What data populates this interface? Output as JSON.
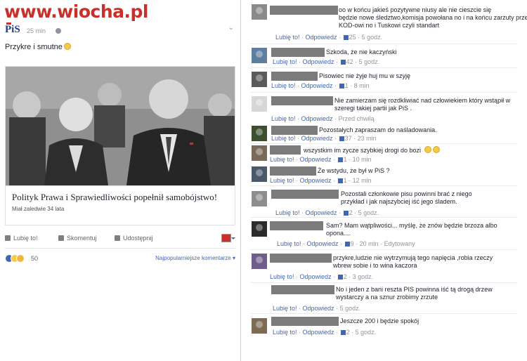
{
  "watermark": "www.wiocha.pl",
  "post": {
    "page_logo": "PiS",
    "time": "25 min",
    "text": "Przykre i smutne",
    "link_title": "Polityk Prawa i Sprawiedliwości popełnił samobójstwo!",
    "link_desc": "Miał zaledwie 34 lata",
    "actions": {
      "like": "Lubię to!",
      "comment": "Skomentuj",
      "share": "Udostępnij"
    },
    "reactions_count": "50",
    "sort_label": "Najpopularniejsze komentarze ▾"
  },
  "comments": [
    {
      "text": "oo w końcu jakieś pozytywne niusy ale nie cieszcie się\nbędzie nowe śledztwo,komisja powołana no i na końcu zarzuty przeciwko\nKOD-owi no i Tuskowi czyli standart",
      "meta": {
        "like": "Lubię to!",
        "reply": "Odpowiedz",
        "count": "25",
        "time": "5 godz."
      }
    },
    {
      "text": "Szkoda, że nie kaczyński",
      "meta": {
        "like": "Lubię to!",
        "reply": "Odpowiedz",
        "count": "42",
        "time": "5 godz."
      }
    },
    {
      "text": "Pisowiec nie żyje huj mu w szyję",
      "meta": {
        "like": "Lubię to!",
        "reply": "Odpowiedz",
        "count": "1",
        "time": "8 min"
      }
    },
    {
      "text": "Nie zamierzam się rozdkliwiać nad człowiekiem który wstąpił w\nszeregi takiej partii jak PiS .",
      "meta": {
        "like": "Lubię to!",
        "reply": "Odpowiedz",
        "count": "",
        "time": "Przed chwilą"
      }
    },
    {
      "text": "Pozostałych zapraszam do naśladowania.",
      "meta": {
        "like": "Lubię to!",
        "reply": "Odpowiedz",
        "count": "37",
        "time": "23 min"
      }
    },
    {
      "text": "wszystkim im zycze szybkiej drogi do bozi",
      "meta": {
        "like": "Lubię to!",
        "reply": "Odpowiedz",
        "count": "1",
        "time": "10 min"
      }
    },
    {
      "text": "Że wstydu, że był w PiS ?",
      "meta": {
        "like": "Lubię to!",
        "reply": "Odpowiedz",
        "count": "1",
        "time": "12 min"
      }
    },
    {
      "text": "Pozostali członkowie pisu powinni brać z niego\nprzykład i jak najszybciej iść jego śladem.",
      "meta": {
        "like": "Lubię to!",
        "reply": "Odpowiedz",
        "count": "2",
        "time": "5 godz."
      }
    },
    {
      "text": "Sam? Mam wątpliwości... myślę, że znów będzie brzoza albo\nopona....",
      "meta": {
        "like": "Lubię to!",
        "reply": "Odpowiedz",
        "count": "9",
        "time": "20 min",
        "extra": "Edytowany"
      }
    },
    {
      "text": "przykre,ludzie nie wytrzymują tego napięcia ,robia rzeczy\nwbrew sobie i to wina kaczora",
      "meta": {
        "like": "Lubię to!",
        "reply": "Odpowiedz",
        "count": "2",
        "time": "3 godz."
      }
    },
    {
      "text": "No i jeden z bani reszta PIS powinna iść tą drogą drzew\nwystarczy a na sznur zrobimy zrzute",
      "meta": {
        "like": "Lubię to!",
        "reply": "Odpowiedz",
        "count": "",
        "time": "5 godz."
      }
    },
    {
      "text": "Jeszcze 200 i będzie spokój",
      "meta": {
        "like": "Lubię to!",
        "reply": "Odpowiedz",
        "count": "2",
        "time": "5 godz."
      }
    }
  ]
}
